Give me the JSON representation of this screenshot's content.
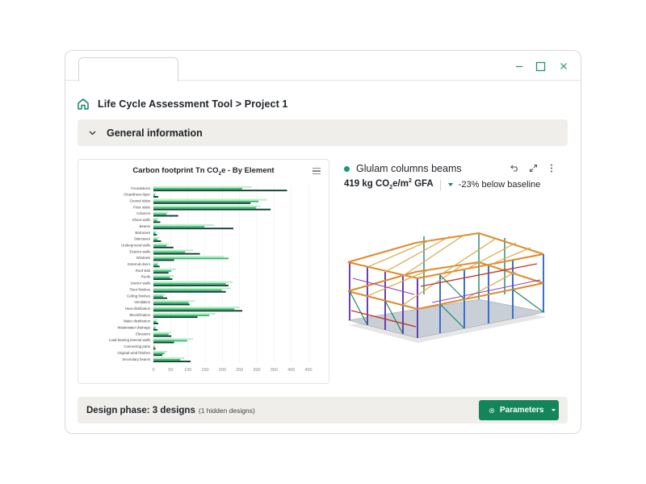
{
  "window": {
    "tab_label": "",
    "controls": [
      "minimize-icon",
      "maximize-icon",
      "close-icon"
    ]
  },
  "breadcrumb": {
    "icon": "home-icon",
    "text": "Life Cycle Assessment Tool > Project 1"
  },
  "general_info": {
    "title": "General information",
    "expanded": true
  },
  "chart": {
    "title_pre": "Carbon footprint Tn CO",
    "title_sub": "2",
    "title_post": "e - By Element",
    "menu_icon": "hamburger-menu-icon"
  },
  "chart_data": {
    "type": "bar",
    "orientation": "horizontal",
    "title": "Carbon footprint Tn CO2e - By Element",
    "categories": [
      "Foundations",
      "Cleanliness layer",
      "Ground slabs",
      "Floor slabs",
      "Columns",
      "Shear walls",
      "Beams",
      "Balconies",
      "Staircases",
      "Underground walls",
      "Exterior walls",
      "Windows",
      "External doors",
      "Roof slab",
      "Roofs",
      "Interior walls",
      "Floor finishes",
      "Ceiling finishes",
      "Ventilation",
      "Heat distribution",
      "Electrification",
      "Water distribution",
      "Wastewater drainage",
      "Elevators",
      "Load bearing internal walls",
      "Connecting parts",
      "Original wind finishes",
      "Secondary beams"
    ],
    "xlim": [
      0,
      450
    ],
    "xticks": [
      0,
      50,
      100,
      150,
      200,
      250,
      300,
      350,
      400,
      450
    ],
    "grid": true,
    "legend": "none",
    "series": [
      {
        "color": "#b9ecc8",
        "values": [
          285,
          8,
          330,
          310,
          45,
          15,
          175,
          8,
          18,
          45,
          115,
          205,
          15,
          65,
          60,
          230,
          225,
          35,
          120,
          250,
          180,
          12,
          8,
          50,
          115,
          5,
          40,
          90
        ]
      },
      {
        "color": "#2fbf6b",
        "values": [
          258,
          5,
          305,
          298,
          38,
          11,
          148,
          6,
          12,
          38,
          92,
          218,
          12,
          52,
          48,
          210,
          198,
          28,
          102,
          235,
          162,
          9,
          6,
          44,
          98,
          4,
          32,
          78
        ]
      },
      {
        "color": "#0f3d2e",
        "values": [
          388,
          14,
          282,
          340,
          72,
          20,
          232,
          10,
          22,
          58,
          135,
          60,
          18,
          44,
          55,
          218,
          210,
          40,
          105,
          258,
          128,
          14,
          12,
          52,
          60,
          6,
          26,
          108
        ]
      }
    ],
    "colors": {
      "light": "#b9ecc8",
      "mid": "#2fbf6b",
      "dark": "#0f3d2e"
    }
  },
  "detail": {
    "status_color": "#1b9a6a",
    "title": "Glulam columns beams",
    "tools": [
      "undo-icon",
      "expand-icon",
      "more-vertical-icon"
    ],
    "metric_value": "419 kg CO",
    "metric_sub": "2",
    "metric_mid": "e/m",
    "metric_sup": "2",
    "metric_unit": " GFA",
    "trend_icon": "trend-down-icon",
    "delta": "-23% below baseline",
    "model_image": "3d-structural-model"
  },
  "bottom": {
    "phase_label": "Design phase: 3 designs",
    "phase_note": "(1 hidden designs)",
    "button_label": "Parameters",
    "button_icon": "cog-icon",
    "button_caret": "caret-down-icon",
    "accent": "#14855a"
  }
}
